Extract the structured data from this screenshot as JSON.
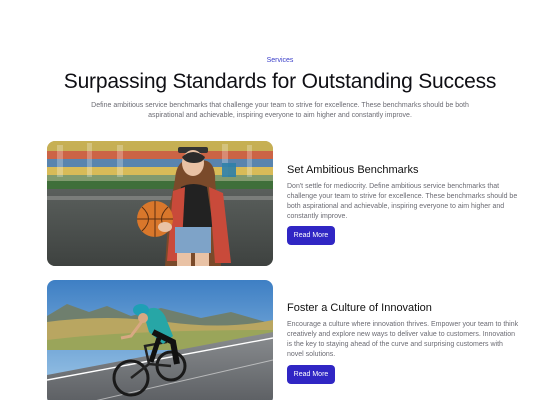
{
  "header": {
    "eyebrow": "Services",
    "title": "Surpassing Standards for Outstanding Success",
    "subtitle": "Define ambitious service benchmarks that challenge your team to strive for excellence. These benchmarks should be both aspirational and achievable, inspiring everyone to aim higher and constantly improve."
  },
  "services": [
    {
      "title": "Set Ambitious Benchmarks",
      "text": "Don't settle for mediocrity. Define ambitious service benchmarks that challenge your team to strive for excellence. These benchmarks should be both aspirational and achievable, inspiring everyone to aim higher and constantly improve.",
      "button": "Read More",
      "image": "woman-holding-basketball-photo"
    },
    {
      "title": "Foster a Culture of Innovation",
      "text": "Encourage a culture where innovation thrives. Empower your team to think creatively and explore new ways to deliver value to customers. Innovation is the key to staying ahead of the curve and surprising customers with novel solutions.",
      "button": "Read More",
      "image": "cyclist-road-photo"
    }
  ],
  "colors": {
    "accent": "#3026c4",
    "eyebrow": "#3b3fc9",
    "body_text": "#6b6b73"
  }
}
